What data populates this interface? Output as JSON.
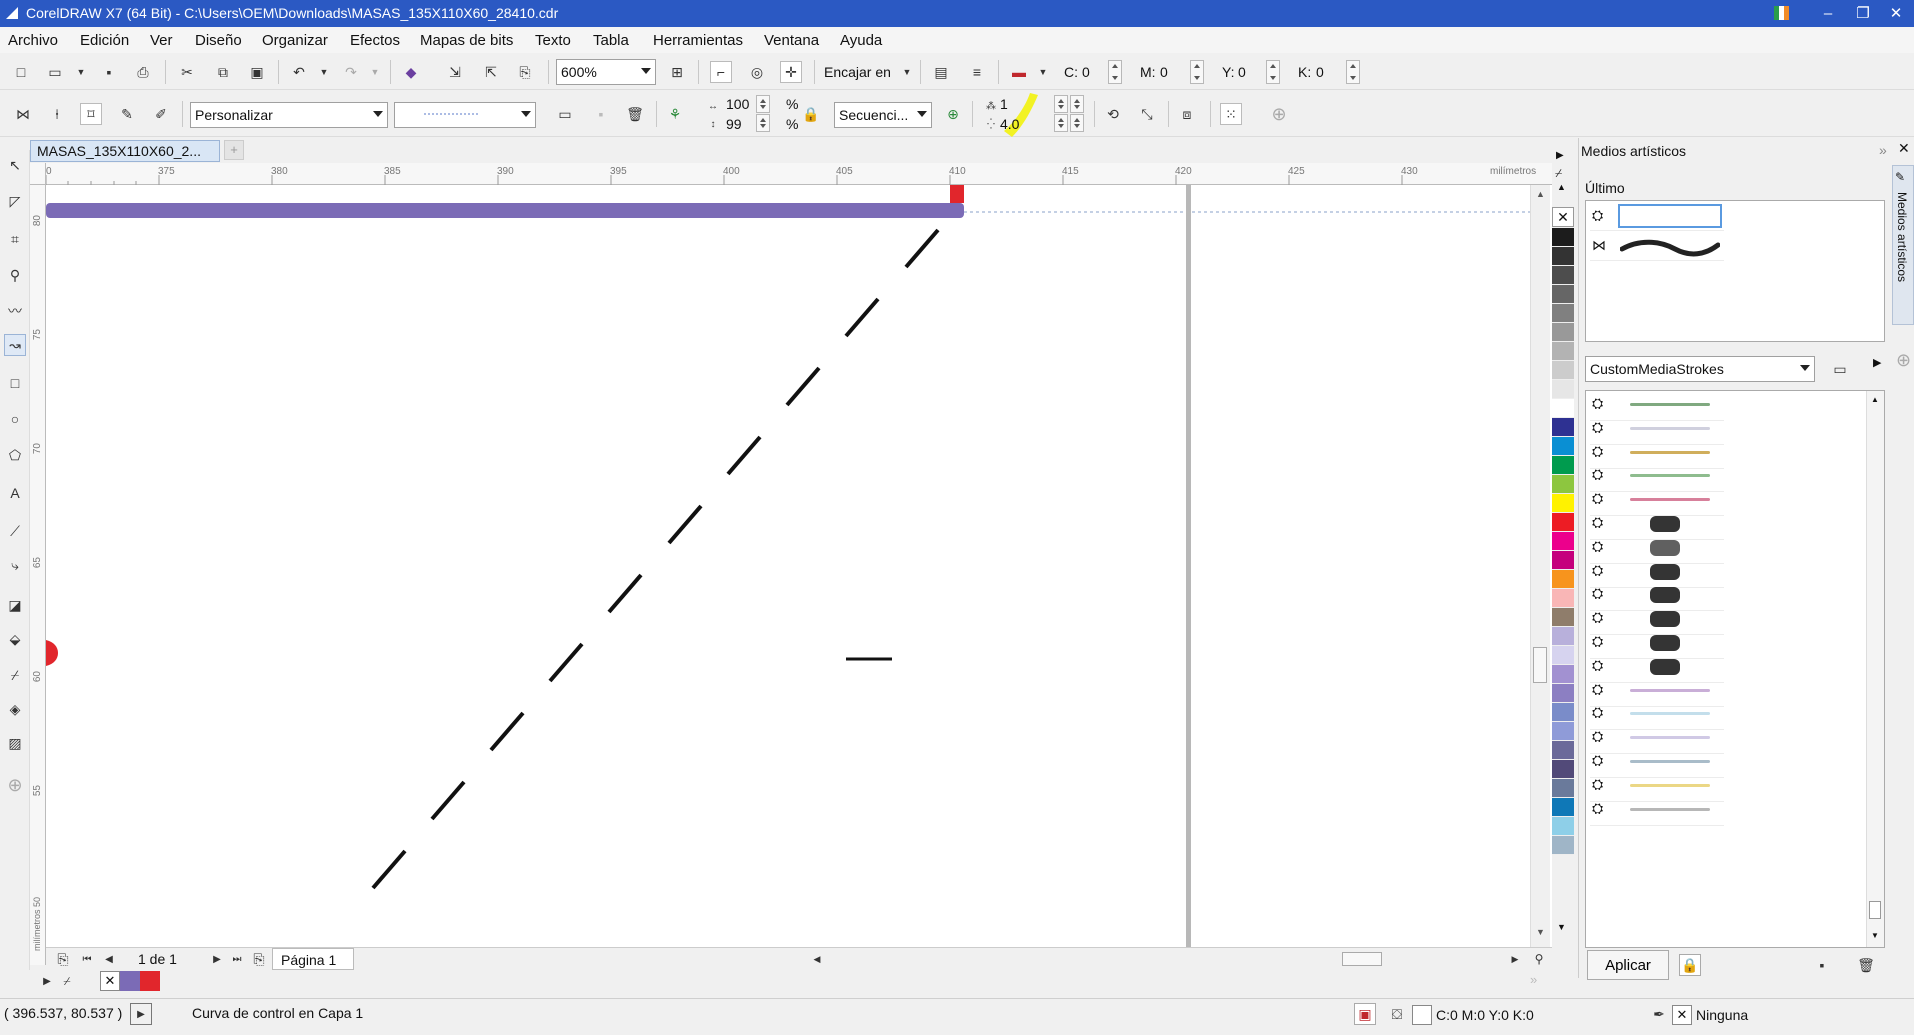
{
  "window": {
    "title": "CorelDRAW X7 (64 Bit) - C:\\Users\\OEM\\Downloads\\MASAS_135X110X60_28410.cdr",
    "minimize": "–",
    "maximize": "❐",
    "close": "✕"
  },
  "menu": [
    "Archivo",
    "Edición",
    "Ver",
    "Diseño",
    "Organizar",
    "Efectos",
    "Mapas de bits",
    "Texto",
    "Tabla",
    "Herramientas",
    "Ventana",
    "Ayuda"
  ],
  "standard_toolbar": {
    "zoom": "600%",
    "snap_to": "Encajar en",
    "c_label": "C:",
    "c_value": "0",
    "m_label": "M:",
    "m_value": "0",
    "y_label": "Y:",
    "y_value": "0",
    "k_label": "K:",
    "k_value": "0"
  },
  "property_bar": {
    "preset": "Personalizar",
    "width_pct": "100",
    "height_pct": "99",
    "pct_symbol": "%",
    "fill_mode": "Secuenci...",
    "spacing_top": "1",
    "spacing_bottom": "4.0"
  },
  "document_tab": {
    "label": "MASAS_135X110X60_2...",
    "add": "+"
  },
  "ruler": {
    "unit": "milímetros",
    "h_ticks": [
      "0",
      "375",
      "380",
      "385",
      "390",
      "395",
      "400",
      "405",
      "410",
      "415",
      "420",
      "425",
      "430"
    ],
    "v_ticks": [
      "80",
      "75",
      "70",
      "65",
      "60",
      "55",
      "milímetros 50"
    ]
  },
  "page_nav": {
    "counter": "1 de 1",
    "page_tab": "Página 1"
  },
  "docker": {
    "title": "Medios artísticos",
    "side_tab": "Medios artísticos",
    "recent_label": "Último",
    "library": "CustomMediaStrokes",
    "apply": "Aplicar"
  },
  "status": {
    "coords": "( 396.537, 80.537 )",
    "object_info": "Curva de control en Capa 1",
    "fill_info": "C:0 M:0 Y:0 K:0",
    "outline_info": "Ninguna"
  },
  "palette_colors": [
    "#1c1c1c",
    "#333333",
    "#4d4d4d",
    "#666666",
    "#808080",
    "#999999",
    "#b3b3b3",
    "#cccccc",
    "#e6e6e6",
    "#ffffff",
    "#2e3192",
    "#0a8fd3",
    "#009b4e",
    "#8dc63f",
    "#fff200",
    "#ed1c24",
    "#ec008c",
    "#c5007d",
    "#f7941d",
    "#f9b6b6",
    "#8f7d6b",
    "#b8b0db",
    "#d6d3ef",
    "#a291d1",
    "#8c7fc2",
    "#7a8cc9",
    "#8f9bd8",
    "#6b6a9a",
    "#524a79",
    "#6a7a9b",
    "#0f78b7",
    "#8ecfe8",
    "#9fb5c7"
  ],
  "doc_palette_colors": [
    "#7b6bb6",
    "#e1262c"
  ]
}
